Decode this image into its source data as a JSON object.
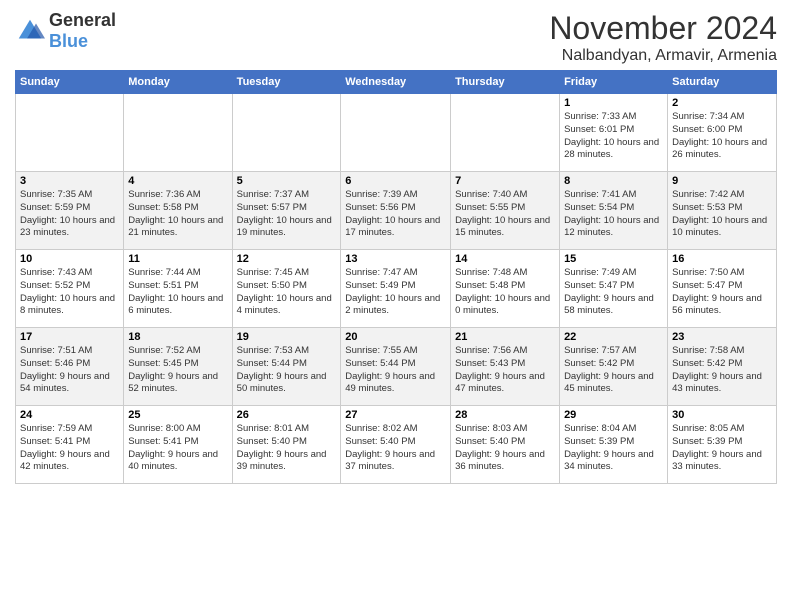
{
  "header": {
    "logo_general": "General",
    "logo_blue": "Blue",
    "month_title": "November 2024",
    "location": "Nalbandyan, Armavir, Armenia"
  },
  "weekdays": [
    "Sunday",
    "Monday",
    "Tuesday",
    "Wednesday",
    "Thursday",
    "Friday",
    "Saturday"
  ],
  "weeks": [
    [
      {
        "day": "",
        "info": ""
      },
      {
        "day": "",
        "info": ""
      },
      {
        "day": "",
        "info": ""
      },
      {
        "day": "",
        "info": ""
      },
      {
        "day": "",
        "info": ""
      },
      {
        "day": "1",
        "info": "Sunrise: 7:33 AM\nSunset: 6:01 PM\nDaylight: 10 hours and 28 minutes."
      },
      {
        "day": "2",
        "info": "Sunrise: 7:34 AM\nSunset: 6:00 PM\nDaylight: 10 hours and 26 minutes."
      }
    ],
    [
      {
        "day": "3",
        "info": "Sunrise: 7:35 AM\nSunset: 5:59 PM\nDaylight: 10 hours and 23 minutes."
      },
      {
        "day": "4",
        "info": "Sunrise: 7:36 AM\nSunset: 5:58 PM\nDaylight: 10 hours and 21 minutes."
      },
      {
        "day": "5",
        "info": "Sunrise: 7:37 AM\nSunset: 5:57 PM\nDaylight: 10 hours and 19 minutes."
      },
      {
        "day": "6",
        "info": "Sunrise: 7:39 AM\nSunset: 5:56 PM\nDaylight: 10 hours and 17 minutes."
      },
      {
        "day": "7",
        "info": "Sunrise: 7:40 AM\nSunset: 5:55 PM\nDaylight: 10 hours and 15 minutes."
      },
      {
        "day": "8",
        "info": "Sunrise: 7:41 AM\nSunset: 5:54 PM\nDaylight: 10 hours and 12 minutes."
      },
      {
        "day": "9",
        "info": "Sunrise: 7:42 AM\nSunset: 5:53 PM\nDaylight: 10 hours and 10 minutes."
      }
    ],
    [
      {
        "day": "10",
        "info": "Sunrise: 7:43 AM\nSunset: 5:52 PM\nDaylight: 10 hours and 8 minutes."
      },
      {
        "day": "11",
        "info": "Sunrise: 7:44 AM\nSunset: 5:51 PM\nDaylight: 10 hours and 6 minutes."
      },
      {
        "day": "12",
        "info": "Sunrise: 7:45 AM\nSunset: 5:50 PM\nDaylight: 10 hours and 4 minutes."
      },
      {
        "day": "13",
        "info": "Sunrise: 7:47 AM\nSunset: 5:49 PM\nDaylight: 10 hours and 2 minutes."
      },
      {
        "day": "14",
        "info": "Sunrise: 7:48 AM\nSunset: 5:48 PM\nDaylight: 10 hours and 0 minutes."
      },
      {
        "day": "15",
        "info": "Sunrise: 7:49 AM\nSunset: 5:47 PM\nDaylight: 9 hours and 58 minutes."
      },
      {
        "day": "16",
        "info": "Sunrise: 7:50 AM\nSunset: 5:47 PM\nDaylight: 9 hours and 56 minutes."
      }
    ],
    [
      {
        "day": "17",
        "info": "Sunrise: 7:51 AM\nSunset: 5:46 PM\nDaylight: 9 hours and 54 minutes."
      },
      {
        "day": "18",
        "info": "Sunrise: 7:52 AM\nSunset: 5:45 PM\nDaylight: 9 hours and 52 minutes."
      },
      {
        "day": "19",
        "info": "Sunrise: 7:53 AM\nSunset: 5:44 PM\nDaylight: 9 hours and 50 minutes."
      },
      {
        "day": "20",
        "info": "Sunrise: 7:55 AM\nSunset: 5:44 PM\nDaylight: 9 hours and 49 minutes."
      },
      {
        "day": "21",
        "info": "Sunrise: 7:56 AM\nSunset: 5:43 PM\nDaylight: 9 hours and 47 minutes."
      },
      {
        "day": "22",
        "info": "Sunrise: 7:57 AM\nSunset: 5:42 PM\nDaylight: 9 hours and 45 minutes."
      },
      {
        "day": "23",
        "info": "Sunrise: 7:58 AM\nSunset: 5:42 PM\nDaylight: 9 hours and 43 minutes."
      }
    ],
    [
      {
        "day": "24",
        "info": "Sunrise: 7:59 AM\nSunset: 5:41 PM\nDaylight: 9 hours and 42 minutes."
      },
      {
        "day": "25",
        "info": "Sunrise: 8:00 AM\nSunset: 5:41 PM\nDaylight: 9 hours and 40 minutes."
      },
      {
        "day": "26",
        "info": "Sunrise: 8:01 AM\nSunset: 5:40 PM\nDaylight: 9 hours and 39 minutes."
      },
      {
        "day": "27",
        "info": "Sunrise: 8:02 AM\nSunset: 5:40 PM\nDaylight: 9 hours and 37 minutes."
      },
      {
        "day": "28",
        "info": "Sunrise: 8:03 AM\nSunset: 5:40 PM\nDaylight: 9 hours and 36 minutes."
      },
      {
        "day": "29",
        "info": "Sunrise: 8:04 AM\nSunset: 5:39 PM\nDaylight: 9 hours and 34 minutes."
      },
      {
        "day": "30",
        "info": "Sunrise: 8:05 AM\nSunset: 5:39 PM\nDaylight: 9 hours and 33 minutes."
      }
    ]
  ]
}
